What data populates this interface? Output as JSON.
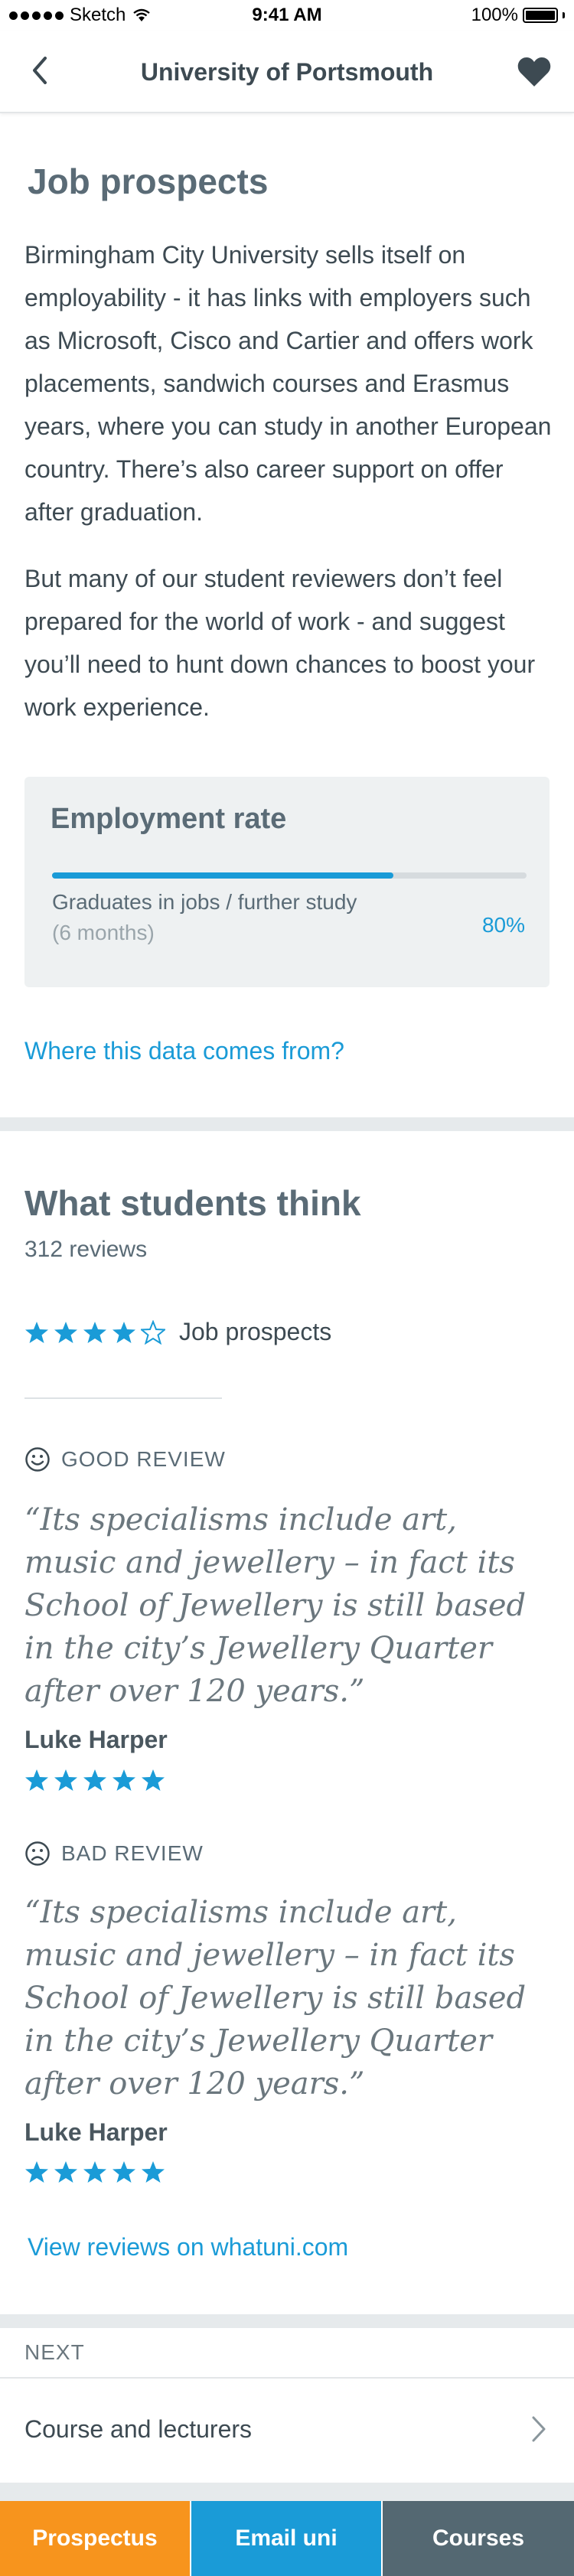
{
  "colors": {
    "accent": "#1a9bd7",
    "prospectus": "#f7941d",
    "courses": "#546872",
    "card_bg": "#eef1f2"
  },
  "status_bar": {
    "carrier": "Sketch",
    "time": "9:41 AM",
    "battery": "100%"
  },
  "nav": {
    "title": "University of Portsmouth",
    "back_icon": "chevron-left-icon",
    "favourite_icon": "heart-icon"
  },
  "job_prospects": {
    "heading": "Job prospects",
    "paragraph_1": "Birmingham City University sells itself on employability - it has links with employers such as Microsoft, Cisco and Cartier and offers work placements, sandwich courses and Erasmus years, where you can study in another European country. There’s also career support on offer after graduation.",
    "paragraph_2": "But many of our student reviewers don’t feel prepared for the world of work - and suggest you’ll need to hunt down chances to boost your work experience."
  },
  "employment": {
    "title": "Employment rate",
    "label": "Graduates in jobs / further study",
    "sublabel": "(6 months)",
    "value_text": "80%",
    "fill_fraction": 0.72,
    "data_link": "Where this data comes from?"
  },
  "students": {
    "heading": "What students think",
    "review_count": "312 reviews",
    "rating_label": "Job prospects",
    "rating_stars": 4,
    "reviews": [
      {
        "type_label": "GOOD REVIEW",
        "icon": "smile-icon",
        "quote": "“Its specialisms include art, music and jewellery – in fact its School of Jewellery is still based in the city’s Jewellery Quarter after over 120 years.”",
        "author": "Luke Harper",
        "stars": 5
      },
      {
        "type_label": "BAD REVIEW",
        "icon": "frown-icon",
        "quote": "“Its specialisms include art, music and jewellery – in fact its School of Jewellery is still based in the city’s Jewellery Quarter after over 120 years.”",
        "author": "Luke Harper",
        "stars": 5
      }
    ],
    "view_link": "View reviews on whatuni.com"
  },
  "next": {
    "label": "NEXT",
    "item": "Course and lecturers"
  },
  "tabbar": {
    "prospectus": "Prospectus",
    "email": "Email uni",
    "courses": "Courses"
  }
}
